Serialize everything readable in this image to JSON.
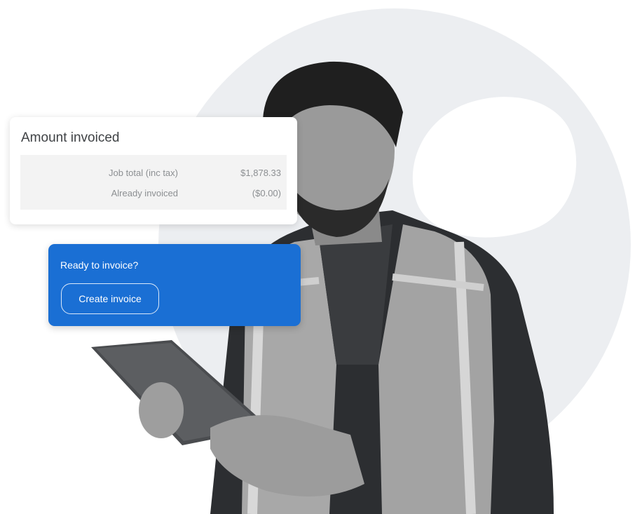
{
  "amount_card": {
    "title": "Amount invoiced",
    "rows": [
      {
        "label": "Job total (inc tax)",
        "value": "$1,878.33"
      },
      {
        "label": "Already invoiced",
        "value": "($0.00)"
      }
    ]
  },
  "ready_card": {
    "title": "Ready to invoice?",
    "button_label": "Create invoice"
  },
  "colors": {
    "accent_blue": "#1a6fd4",
    "background_circle": "#eceef1"
  }
}
